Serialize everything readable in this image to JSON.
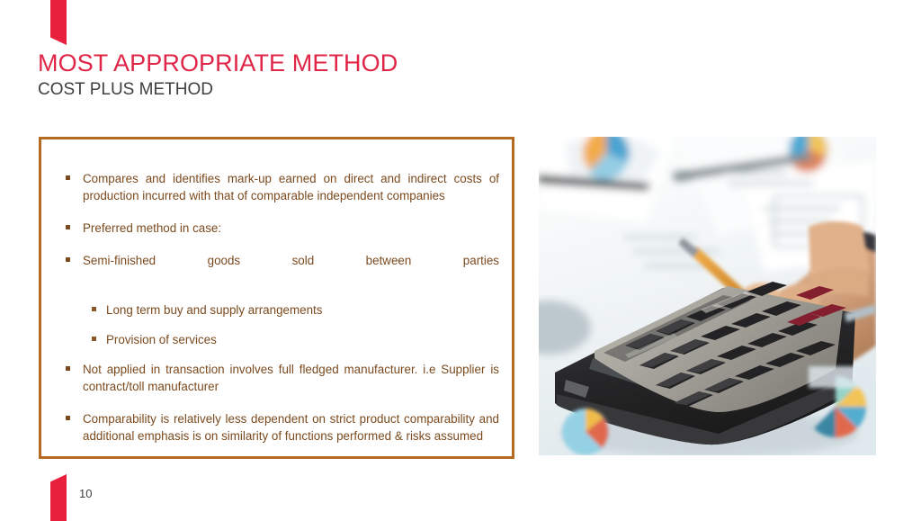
{
  "slide": {
    "title": "MOST APPROPRIATE METHOD",
    "subtitle": "COST PLUS METHOD",
    "page_number": "10",
    "accent_red": "#e02647",
    "ribbon_red": "#e8203e",
    "box_border_brown": "#b56a22",
    "body_text_brown": "#7b4a1e",
    "subtitle_gray": "#3f3f3f"
  },
  "content": {
    "bullets": [
      {
        "level": 1,
        "text": "Compares and identifies mark-up earned on direct and indirect costs of production incurred with that  of comparable independent companies"
      },
      {
        "level": 1,
        "text": "Preferred method in case:"
      },
      {
        "level": 1,
        "text": "Semi-finished goods sold between parties"
      },
      {
        "level": 2,
        "text": "Long term buy and supply arrangements"
      },
      {
        "level": 2,
        "text": "Provision of services"
      },
      {
        "level": 1,
        "text": "Not applied in transaction involves full fledged manufacturer. i.e Supplier is contract/toll manufacturer"
      },
      {
        "level": 1,
        "text": "Comparability is relatively less dependent on strict product comparability and additional emphasis is on similarity of functions performed & risks  assumed"
      }
    ]
  },
  "photo": {
    "alt": "Hand pressing keys of a desktop calculator on a desk with printed charts and reports",
    "subjects": [
      "calculator",
      "hand",
      "pen",
      "financial-documents",
      "pie-chart-printouts"
    ]
  }
}
